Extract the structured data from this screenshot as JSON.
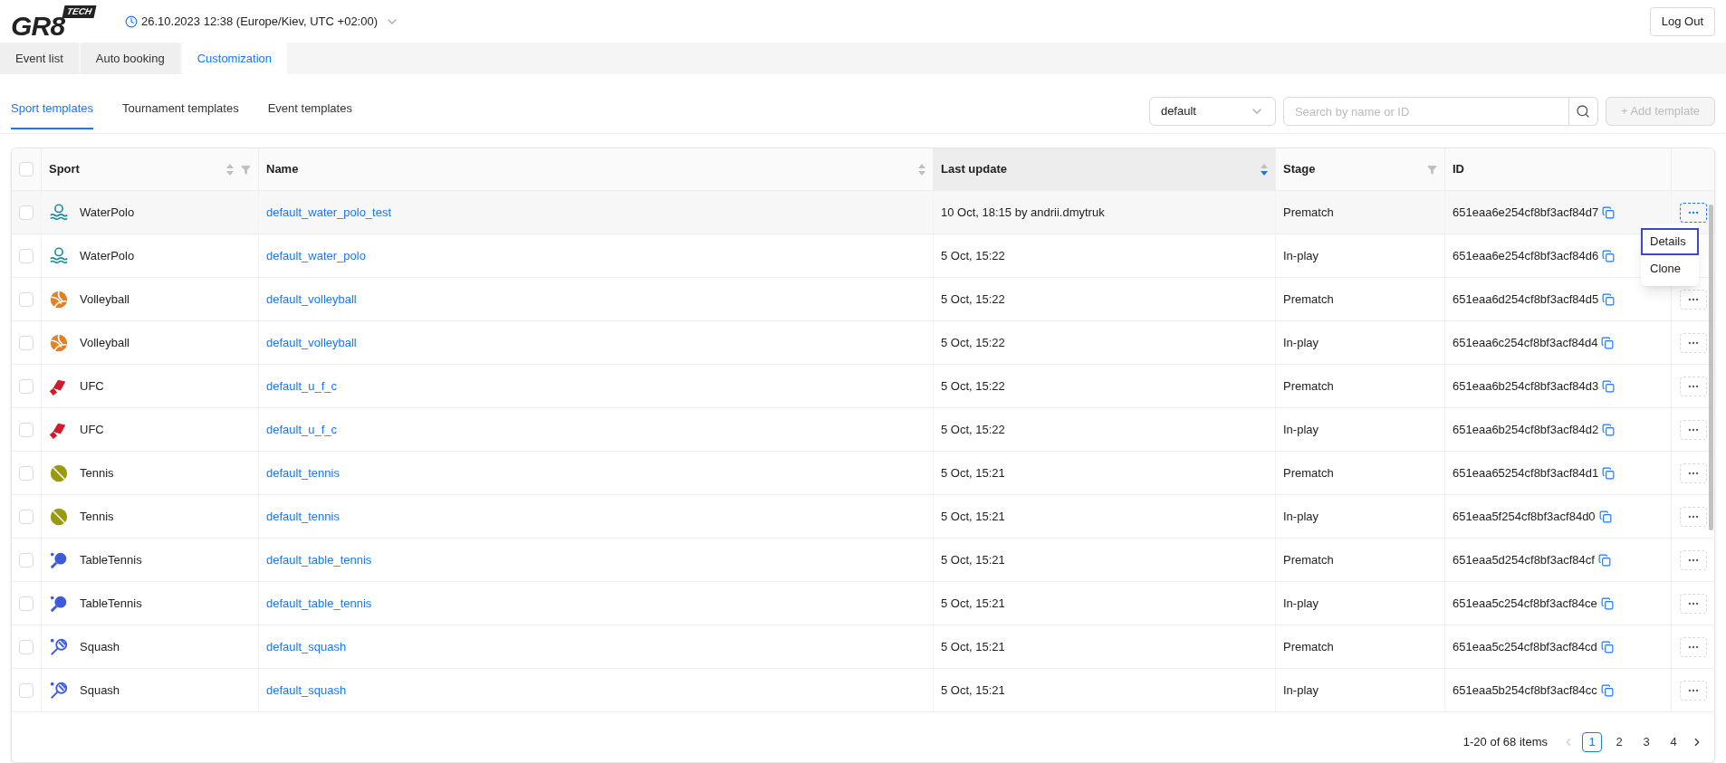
{
  "header": {
    "logo": {
      "main": "GR8",
      "badge": "TECH"
    },
    "datetime": "26.10.2023 12:38 (Europe/Kiev, UTC +02:00)",
    "logout": "Log Out"
  },
  "nav_tabs": [
    {
      "label": "Event list",
      "selected": false
    },
    {
      "label": "Auto booking",
      "selected": false
    },
    {
      "label": "Customization",
      "selected": true
    }
  ],
  "sub_tabs": [
    {
      "label": "Sport templates",
      "selected": true
    },
    {
      "label": "Tournament templates",
      "selected": false
    },
    {
      "label": "Event templates",
      "selected": false
    }
  ],
  "toolbar": {
    "select_value": "default",
    "search": {
      "placeholder": "Search by name or ID"
    },
    "add_button": {
      "label": "+ Add template",
      "disabled": true
    }
  },
  "table": {
    "select_all_checked": false,
    "columns": [
      {
        "label": "Sport",
        "sortable": true,
        "sorted": false,
        "filterable": true
      },
      {
        "label": "Name",
        "sortable": true,
        "sorted": false,
        "filterable": false
      },
      {
        "label": "Last update",
        "sortable": true,
        "sorted": true,
        "filterable": false
      },
      {
        "label": "Stage",
        "sortable": false,
        "filterable": true
      },
      {
        "label": "ID",
        "sortable": false,
        "filterable": false
      }
    ],
    "rows": [
      {
        "checked": false,
        "sport": "WaterPolo",
        "kind": "water_polo",
        "name": "default_water_polo_test",
        "last_update": "10 Oct, 18:15 by andrii.dmytruk",
        "stage": "Prematch",
        "id": "651eaa6e254cf8bf3acf84d7",
        "menu_open": true
      },
      {
        "checked": false,
        "sport": "WaterPolo",
        "kind": "water_polo",
        "name": "default_water_polo",
        "last_update": "5 Oct, 15:22",
        "stage": "In-play",
        "id": "651eaa6e254cf8bf3acf84d6",
        "menu_open": false
      },
      {
        "checked": false,
        "sport": "Volleyball",
        "kind": "volleyball",
        "name": "default_volleyball",
        "last_update": "5 Oct, 15:22",
        "stage": "Prematch",
        "id": "651eaa6d254cf8bf3acf84d5",
        "menu_open": false
      },
      {
        "checked": false,
        "sport": "Volleyball",
        "kind": "volleyball",
        "name": "default_volleyball",
        "last_update": "5 Oct, 15:22",
        "stage": "In-play",
        "id": "651eaa6c254cf8bf3acf84d4",
        "menu_open": false
      },
      {
        "checked": false,
        "sport": "UFC",
        "kind": "ufc",
        "name": "default_u_f_c",
        "last_update": "5 Oct, 15:22",
        "stage": "Prematch",
        "id": "651eaa6b254cf8bf3acf84d3",
        "menu_open": false
      },
      {
        "checked": false,
        "sport": "UFC",
        "kind": "ufc",
        "name": "default_u_f_c",
        "last_update": "5 Oct, 15:22",
        "stage": "In-play",
        "id": "651eaa6b254cf8bf3acf84d2",
        "menu_open": false
      },
      {
        "checked": false,
        "sport": "Tennis",
        "kind": "tennis",
        "name": "default_tennis",
        "last_update": "5 Oct, 15:21",
        "stage": "Prematch",
        "id": "651eaa65254cf8bf3acf84d1",
        "menu_open": false
      },
      {
        "checked": false,
        "sport": "Tennis",
        "kind": "tennis",
        "name": "default_tennis",
        "last_update": "5 Oct, 15:21",
        "stage": "In-play",
        "id": "651eaa5f254cf8bf3acf84d0",
        "menu_open": false
      },
      {
        "checked": false,
        "sport": "TableTennis",
        "kind": "table_tennis",
        "name": "default_table_tennis",
        "last_update": "5 Oct, 15:21",
        "stage": "Prematch",
        "id": "651eaa5d254cf8bf3acf84cf",
        "menu_open": false
      },
      {
        "checked": false,
        "sport": "TableTennis",
        "kind": "table_tennis",
        "name": "default_table_tennis",
        "last_update": "5 Oct, 15:21",
        "stage": "In-play",
        "id": "651eaa5c254cf8bf3acf84ce",
        "menu_open": false
      },
      {
        "checked": false,
        "sport": "Squash",
        "kind": "squash",
        "name": "default_squash",
        "last_update": "5 Oct, 15:21",
        "stage": "Prematch",
        "id": "651eaa5c254cf8bf3acf84cd",
        "menu_open": false
      },
      {
        "checked": false,
        "sport": "Squash",
        "kind": "squash",
        "name": "default_squash",
        "last_update": "5 Oct, 15:21",
        "stage": "In-play",
        "id": "651eaa5b254cf8bf3acf84cc",
        "menu_open": false
      }
    ]
  },
  "row_menu": [
    {
      "label": "Details",
      "selected": true
    },
    {
      "label": "Clone",
      "selected": false
    }
  ],
  "pagination": {
    "summary": "1-20 of 68 items",
    "prev_disabled": true,
    "pages": [
      {
        "label": "1",
        "selected": true
      },
      {
        "label": "2",
        "selected": false
      },
      {
        "label": "3",
        "selected": false
      },
      {
        "label": "4",
        "selected": false
      }
    ]
  }
}
